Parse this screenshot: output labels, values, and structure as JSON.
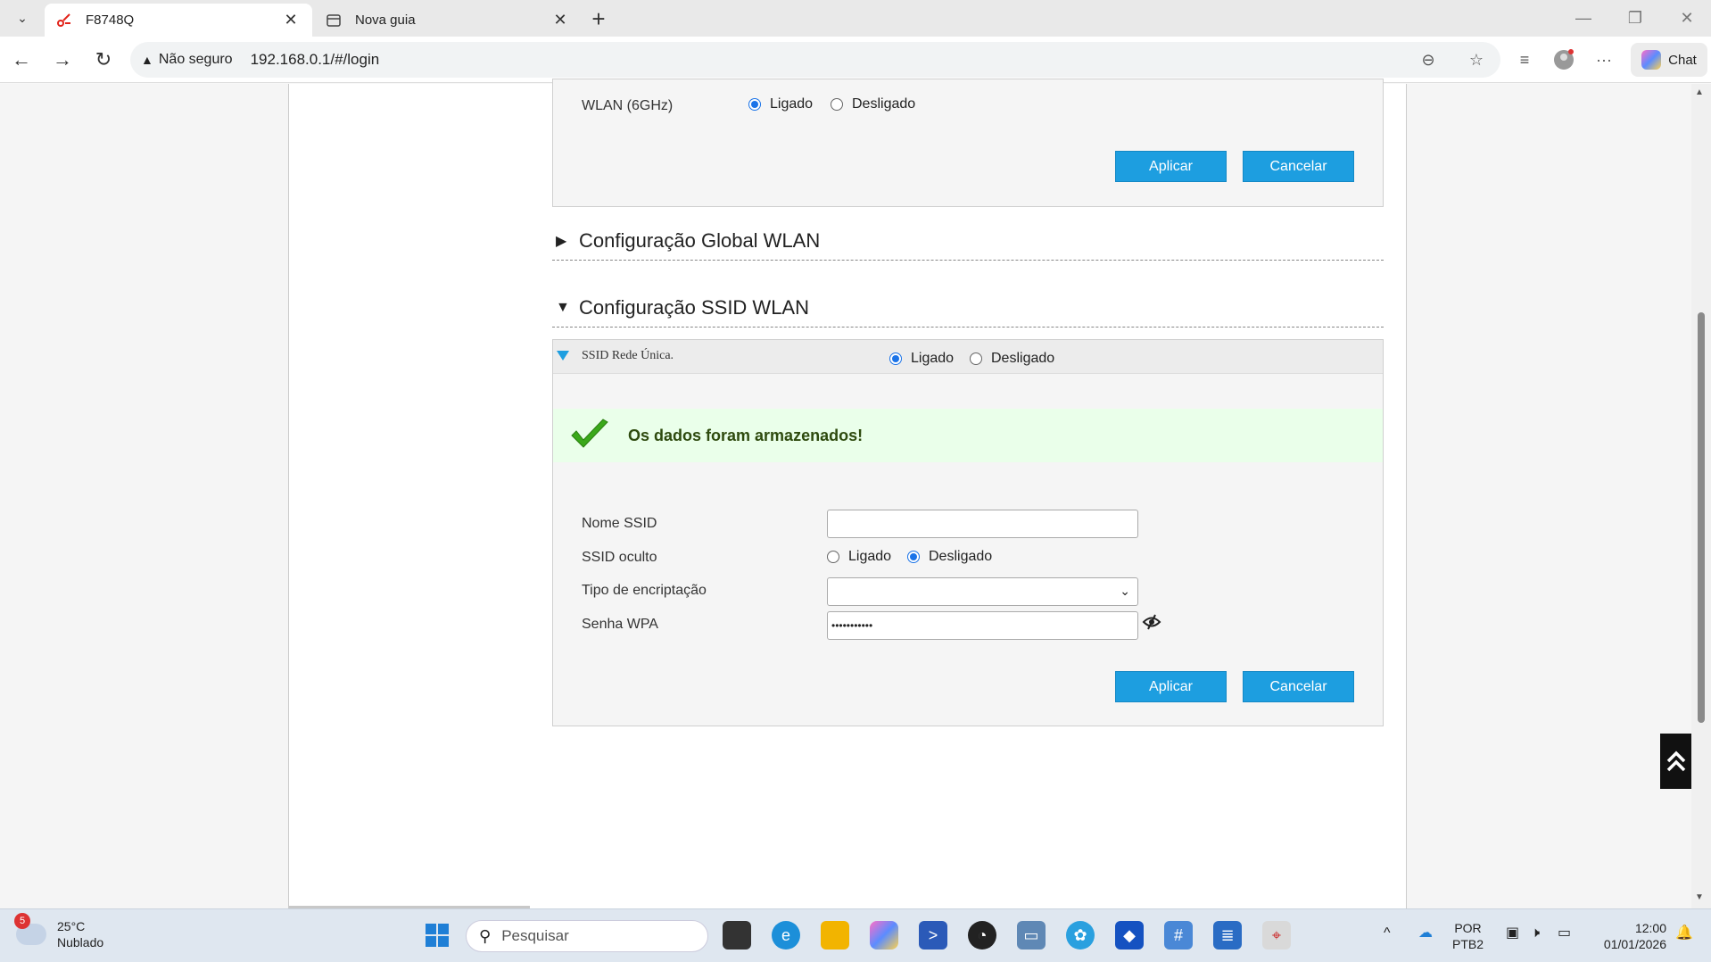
{
  "browser": {
    "tabs": [
      {
        "title": "F8748Q",
        "active": true
      },
      {
        "title": "Nova guia",
        "active": false
      }
    ],
    "security_label": "Não seguro",
    "url": "192.168.0.1/#/login",
    "chat_label": "Chat"
  },
  "wlan6": {
    "label": "WLAN (6GHz)",
    "on_label": "Ligado",
    "off_label": "Desligado",
    "apply": "Aplicar",
    "cancel": "Cancelar"
  },
  "sections": {
    "global": "Configuração Global WLAN",
    "ssid": "Configuração SSID WLAN"
  },
  "ssid": {
    "header_label": "SSID Rede Única.",
    "on_label": "Ligado",
    "off_label": "Desligado",
    "success_message": "Os dados foram armazenados!",
    "fields": {
      "name_label": "Nome SSID",
      "name_value": "",
      "hidden_label": "SSID oculto",
      "hidden_on": "Ligado",
      "hidden_off": "Desligado",
      "encryption_label": "Tipo de encriptação",
      "encryption_value": "",
      "password_label": "Senha WPA",
      "password_value": "•••••••••••"
    },
    "apply": "Aplicar",
    "cancel": "Cancelar"
  },
  "taskbar": {
    "weather_temp": "25°C",
    "weather_desc": "Nublado",
    "weather_badge": "5",
    "search_placeholder": "Pesquisar",
    "lang": "POR",
    "layout": "PTB2",
    "time": "12:00",
    "date": "01/01/2026"
  }
}
